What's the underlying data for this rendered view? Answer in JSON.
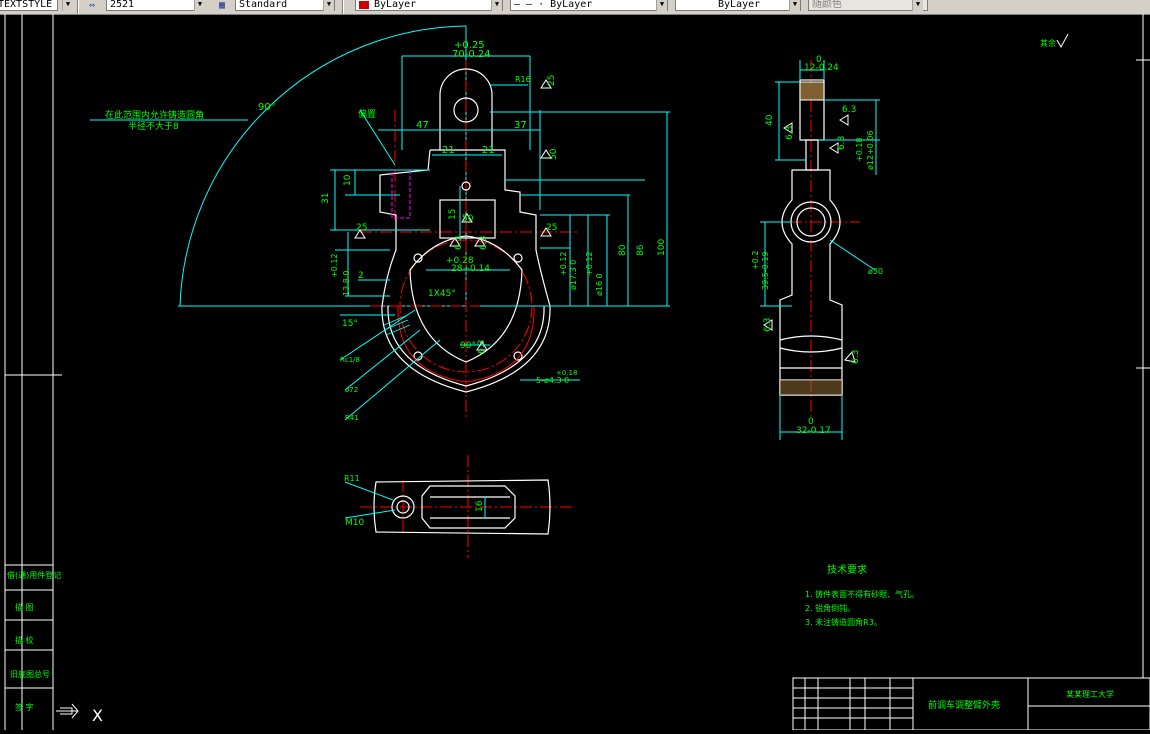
{
  "toolbar": {
    "text_style": "TEXTSTYLE",
    "dim_style_value": "2521",
    "table_style": "Standard",
    "layer_color": "ByLayer",
    "linetype": "— — · ByLayer",
    "lineweight": "ByLayer",
    "plot_style": "随颜色",
    "colors": {
      "layer_swatch": "#cc0000"
    }
  },
  "drawing": {
    "front_view": {
      "tol_upper": "+0.25",
      "overall_width": "70-0.24",
      "radius_top": "R16",
      "rough_25_top": "25",
      "rough_50_right": "50",
      "left_label": "偏置",
      "dim_47": "47",
      "dim_37": "37",
      "dim_21_left": "21",
      "dim_21_right": "21",
      "dim_10": "10",
      "dim_31": "31",
      "dim_15": "15",
      "rough_25_left": "25",
      "rough_25_right": "25",
      "rough_50_center": "50",
      "rough_63_a": "6.3",
      "rough_63_b": "6.3",
      "tol_028": "+0.28",
      "dim_28": "28+0.14",
      "dim_13_tol": "+0.12",
      "dim_13": "13.8  0",
      "dim_2": "2",
      "dim_17_tol": "+0.12",
      "dim_17": "ø17.3  0",
      "dim_16_tol": "+0.12",
      "dim_16": "ø16  0",
      "dim_80": "80",
      "dim_86": "86",
      "dim_100": "100",
      "chamfer": "1X45°",
      "angle_15": "15°",
      "angle_90_mid": "90°",
      "rough_63_c": "6.3",
      "thread": "Rc1/8",
      "dia_72": "ø72",
      "radius_41": "R41",
      "holes": "5-ø4.3  0",
      "holes_tol": "+0.18",
      "arc_angle": "90°",
      "note_line1": "在此范围内允许铸造圆角",
      "note_line2": "半径不大于8"
    },
    "side_view": {
      "top_tol": "0",
      "top_width": "12-0.24",
      "dim_40": "40",
      "rough_63_a": "6.3",
      "rough_63_b": "6.3",
      "rough_63_c": "6.3",
      "dia_12_tol_a": "+0.18",
      "dia_12_tol_b": "ø12+0.06",
      "dim_39_tol": "+0.2",
      "dim_39": "39.5-0.19",
      "dia_30": "ø30",
      "rough_63_d": "6.3",
      "rough_63_e": "6.3",
      "bottom_tol": "0",
      "bottom_width": "32-0.17"
    },
    "bottom_view": {
      "radius": "R11",
      "thread": "M10",
      "dim_16": "16"
    },
    "other_rough": "其余",
    "tech_req": {
      "title": "技术要求",
      "items": [
        "1. 铸件表面不得有砂眼、气孔。",
        "2. 锐角倒钝。",
        "3. 未注铸造圆角R3。"
      ]
    },
    "title_block": {
      "part_name": "前调车调整臂外壳",
      "school": "某某理工大学"
    },
    "left_strip": {
      "labels": [
        "借(通)用件登记",
        "描 图",
        "描 校",
        "旧底图总号",
        "签 字"
      ]
    },
    "ucs": {
      "x_label": "X"
    }
  }
}
